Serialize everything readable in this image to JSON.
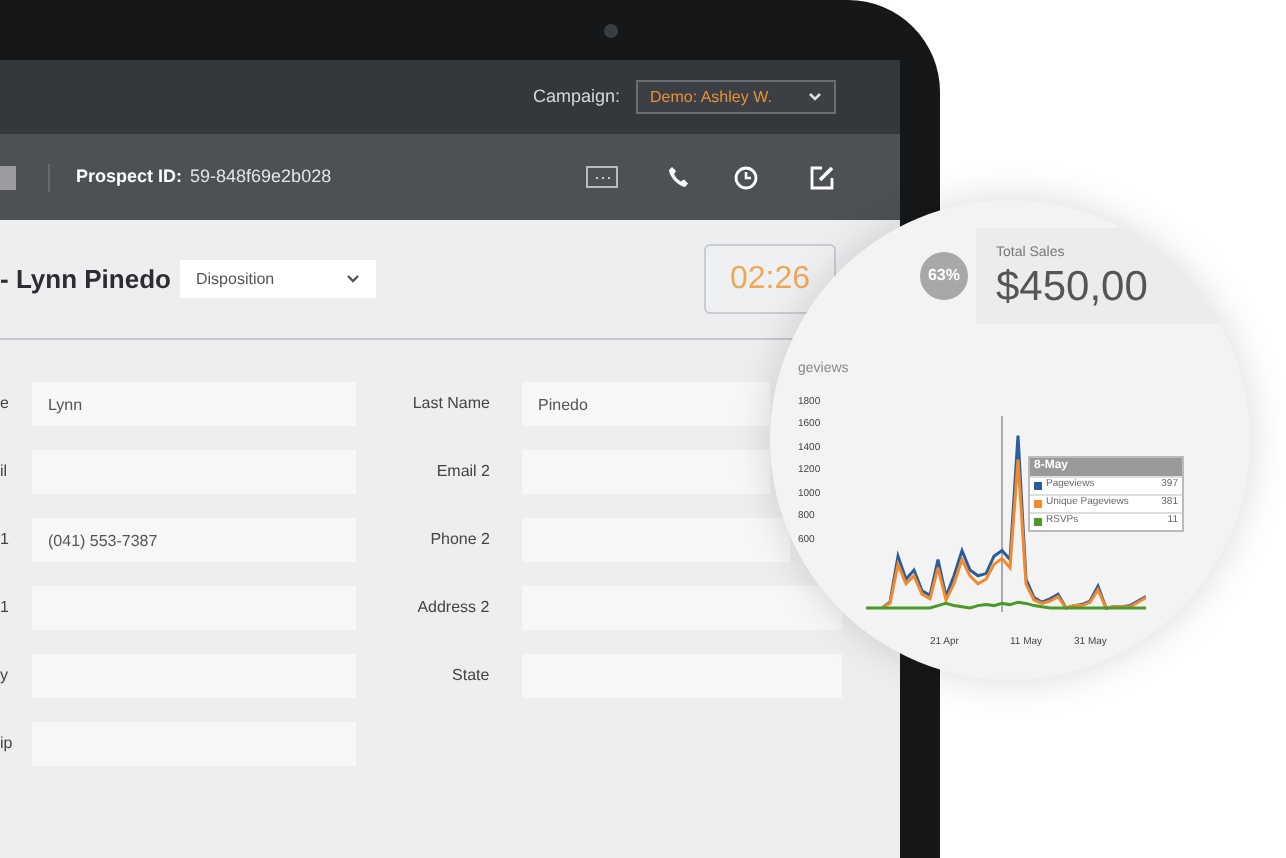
{
  "header": {
    "campaign_label": "Campaign:",
    "campaign_value": "Demo: Ashley W."
  },
  "toolbar": {
    "prospect_label": "Prospect ID:",
    "prospect_id": "59-848f69e2b028"
  },
  "record": {
    "title": "- Lynn Pinedo",
    "disposition": "Disposition",
    "timer": "02:26"
  },
  "fields_left": [
    {
      "label": "e",
      "value": "Lynn"
    },
    {
      "label": "il"
    },
    {
      "label": "1",
      "value": "(041) 553-7387"
    },
    {
      "label": "1"
    },
    {
      "label": "y"
    },
    {
      "label": "ip"
    }
  ],
  "fields_right": [
    {
      "label": "Last Name",
      "value": "Pinedo"
    },
    {
      "label": "Email 2"
    },
    {
      "label": "Phone 2"
    },
    {
      "label": "Address 2"
    },
    {
      "label": "State"
    }
  ],
  "magnifier": {
    "percent": "63%",
    "stat_label": "Total Sales",
    "stat_value": "$450,00",
    "chart_data": {
      "type": "line",
      "title": "geviews",
      "categories": [
        null,
        null,
        null,
        null,
        null,
        null,
        null,
        null,
        null,
        null,
        "21 Apr",
        null,
        null,
        null,
        null,
        null,
        null,
        null,
        null,
        null,
        "11 May",
        null,
        null,
        null,
        null,
        null,
        null,
        null,
        "31 May",
        null,
        null,
        null,
        null,
        null,
        null,
        null
      ],
      "series": [
        {
          "name": "Pageviews",
          "color": "#2b5d9b",
          "values": [
            null,
            null,
            0,
            50,
            450,
            250,
            330,
            150,
            110,
            420,
            100,
            280,
            500,
            330,
            280,
            300,
            450,
            500,
            420,
            1500,
            250,
            90,
            50,
            80,
            120,
            0,
            20,
            30,
            60,
            190,
            0,
            10,
            10,
            20,
            60,
            100
          ]
        },
        {
          "name": "Unique Pageviews",
          "color": "#f08a2c",
          "values": [
            null,
            null,
            0,
            40,
            380,
            210,
            280,
            120,
            80,
            350,
            70,
            210,
            420,
            280,
            210,
            250,
            380,
            430,
            350,
            1290,
            210,
            70,
            40,
            60,
            100,
            0,
            20,
            20,
            50,
            160,
            0,
            10,
            10,
            10,
            50,
            90
          ]
        },
        {
          "name": "RSVPs",
          "color": "#4a9a2a",
          "values": [
            0,
            0,
            0,
            0,
            0,
            0,
            0,
            0,
            0,
            20,
            40,
            20,
            10,
            0,
            20,
            30,
            20,
            40,
            30,
            50,
            40,
            20,
            10,
            0,
            0,
            0,
            0,
            0,
            0,
            0,
            0,
            0,
            0,
            0,
            0,
            0
          ]
        }
      ],
      "ylim": [
        0,
        1800
      ],
      "yticks": [
        1800,
        1600,
        1400,
        1200,
        1000,
        800,
        600
      ]
    },
    "tooltip": {
      "title": "8-May",
      "values": [
        "397",
        "381",
        "11"
      ]
    }
  }
}
